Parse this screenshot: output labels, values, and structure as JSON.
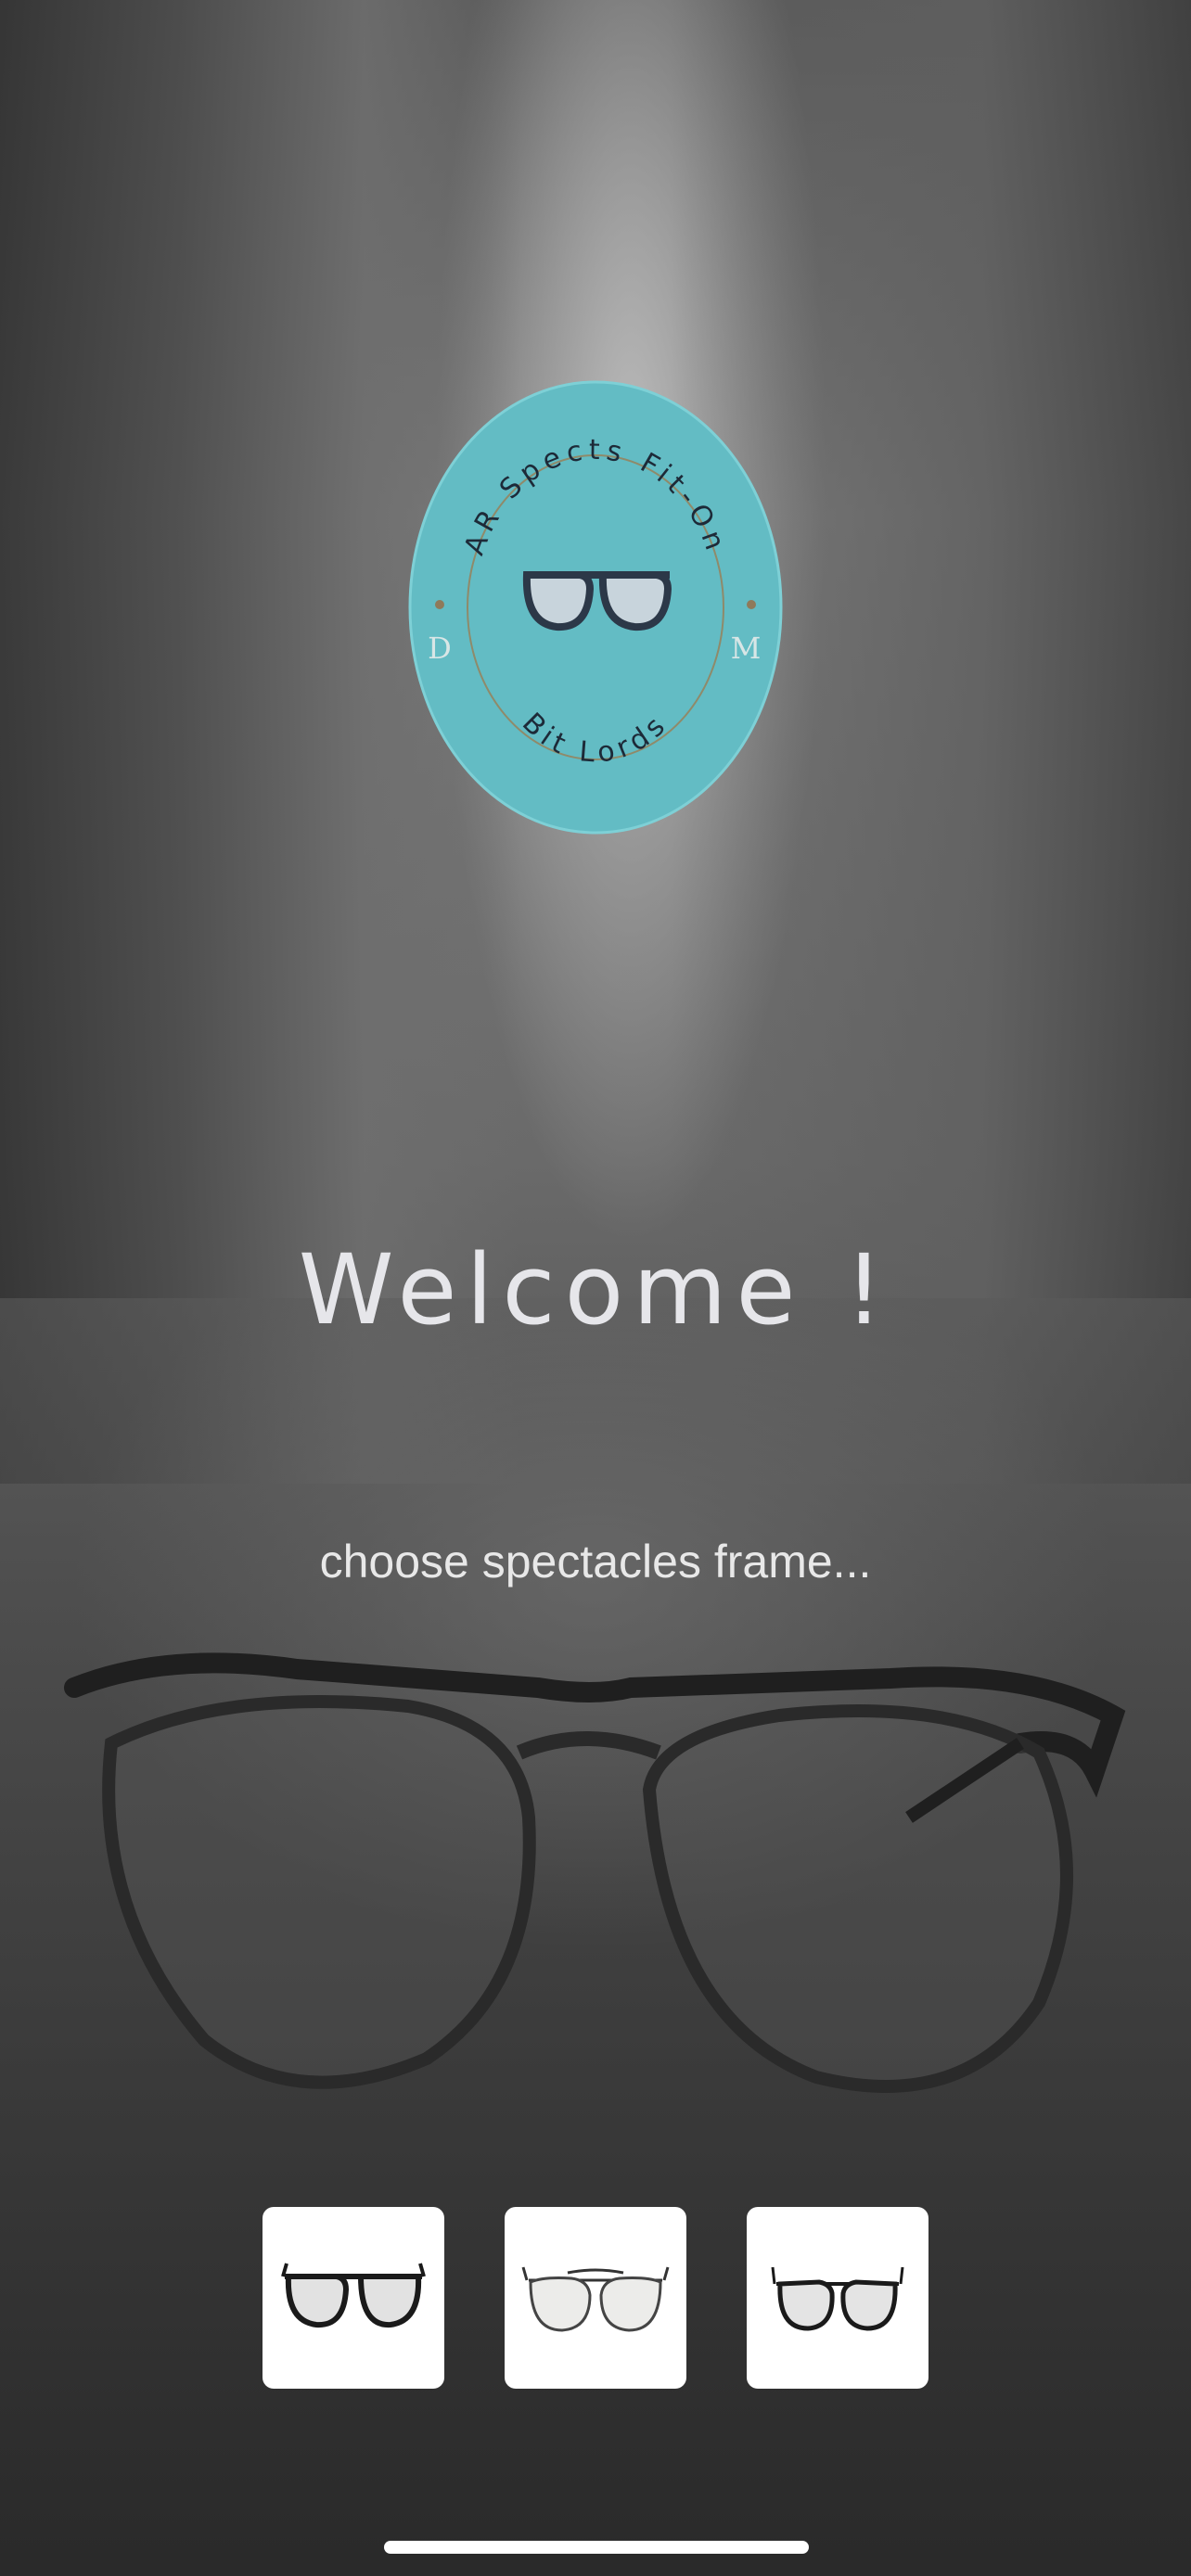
{
  "logo": {
    "ring_text_top": "AR Spects Fit-On",
    "ring_text_bottom": "Bit Lords",
    "initial_left": "D",
    "initial_right": "M",
    "accent_color": "#63bcc4"
  },
  "welcome": {
    "title": "Welcome !"
  },
  "subtitle": "choose spectacles frame...",
  "frames": [
    {
      "icon": "wayfarer-glasses-icon"
    },
    {
      "icon": "aviator-glasses-icon"
    },
    {
      "icon": "round-glasses-icon"
    }
  ]
}
